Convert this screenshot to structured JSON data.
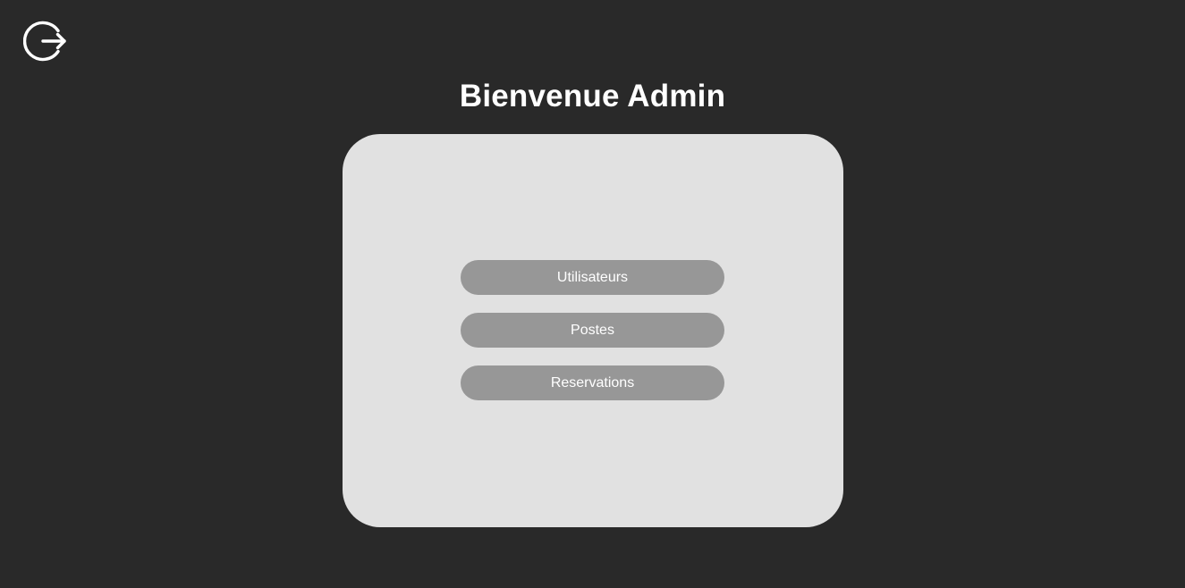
{
  "header": {
    "logout_icon": "logout-icon",
    "title": "Bienvenue Admin"
  },
  "menu": {
    "items": [
      {
        "label": "Utilisateurs"
      },
      {
        "label": "Postes"
      },
      {
        "label": "Reservations"
      }
    ]
  },
  "colors": {
    "background": "#292929",
    "card": "#e1e1e1",
    "button": "#979797",
    "text": "#ffffff"
  }
}
